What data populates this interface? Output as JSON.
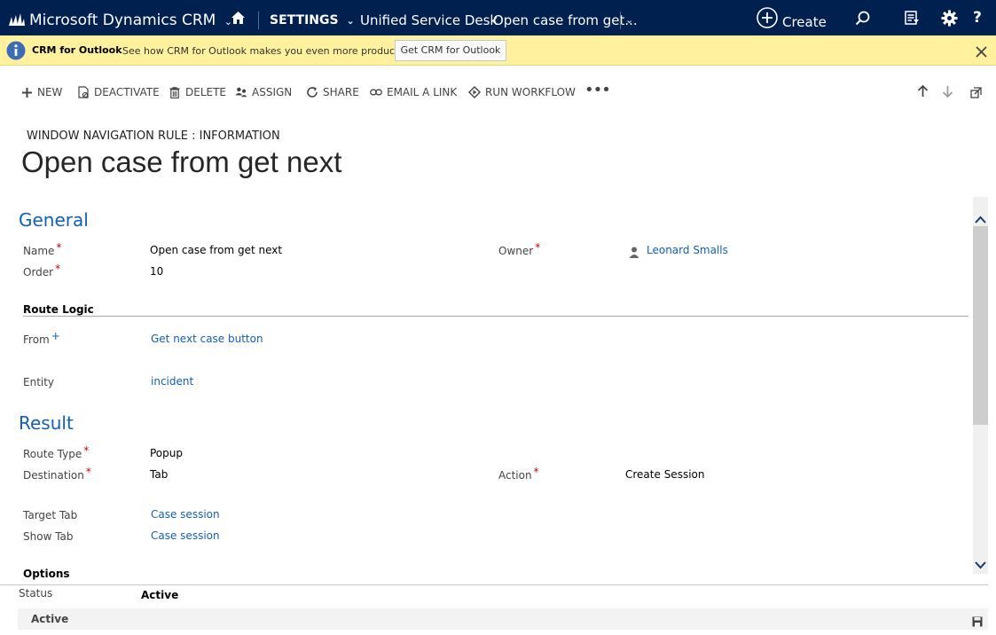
{
  "topnav": {
    "brand": "Microsoft Dynamics CRM",
    "area": "SETTINGS",
    "crumb1": "Unified Service Desk",
    "crumb2": "Open case from get...",
    "create": "Create"
  },
  "notification": {
    "title": "CRM for Outlook",
    "message": "See how CRM for Outlook makes you even more productive.",
    "button": "Get CRM for Outlook"
  },
  "commands": {
    "new": "NEW",
    "deactivate": "DEACTIVATE",
    "delete": "DELETE",
    "assign": "ASSIGN",
    "share": "SHARE",
    "email_link": "EMAIL A LINK",
    "run_workflow": "RUN WORKFLOW"
  },
  "form": {
    "entity_label": "WINDOW NAVIGATION RULE : INFORMATION",
    "record_title": "Open case from get next",
    "general": {
      "heading": "General",
      "name_label": "Name",
      "name_value": "Open case from get next",
      "order_label": "Order",
      "order_value": "10",
      "owner_label": "Owner",
      "owner_value": "Leonard Smalls"
    },
    "route_logic": {
      "heading": "Route Logic",
      "from_label": "From",
      "from_value": "Get next case button",
      "entity_label": "Entity",
      "entity_value": "incident"
    },
    "result": {
      "heading": "Result",
      "route_type_label": "Route Type",
      "route_type_value": "Popup",
      "destination_label": "Destination",
      "destination_value": "Tab",
      "action_label": "Action",
      "action_value": "Create Session",
      "target_tab_label": "Target Tab",
      "target_tab_value": "Case session",
      "show_tab_label": "Show Tab",
      "show_tab_value": "Case session"
    },
    "options": {
      "heading": "Options"
    }
  },
  "footer": {
    "status_label": "Status",
    "status_value": "Active",
    "state_bar": "Active"
  },
  "colors": {
    "nav_bg": "#002050",
    "notif_bg": "#fff19d",
    "link": "#1160b7",
    "required": "#c00000"
  }
}
